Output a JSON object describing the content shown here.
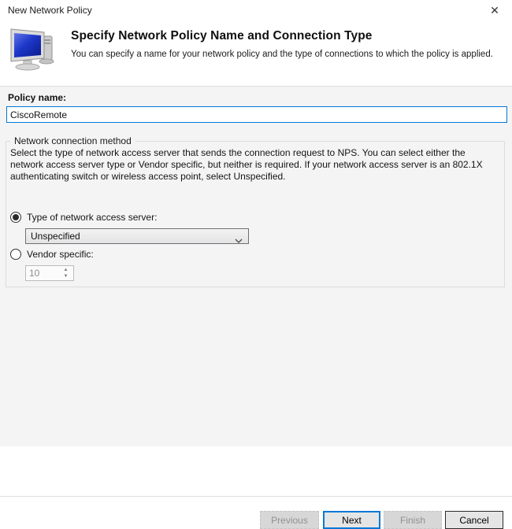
{
  "window": {
    "title": "New Network Policy",
    "close_glyph": "✕"
  },
  "header": {
    "title": "Specify Network Policy Name and Connection Type",
    "subtitle": "You can specify a name for your network policy and the type of connections to which the policy is applied.",
    "icon": "computer-monitor-icon"
  },
  "form": {
    "policy_name_label": "Policy name:",
    "policy_name_value": "CiscoRemote",
    "group": {
      "legend": "Network connection method",
      "description": "Select the type of network access server that sends the connection request to NPS. You can select either the network access server type or Vendor specific, but neither is required.  If your network access server is an 802.1X authenticating switch or wireless access point, select Unspecified.",
      "radio_type": {
        "label": "Type of network access server:",
        "selected": true
      },
      "type_dropdown_value": "Unspecified",
      "radio_vendor": {
        "label": "Vendor specific:",
        "selected": false
      },
      "vendor_value": "10"
    }
  },
  "icons": {
    "spinner_up": "▲",
    "spinner_down": "▼"
  },
  "footer": {
    "buttons": [
      {
        "label": "Previous",
        "state": "disabled"
      },
      {
        "label": "Next",
        "state": "default"
      },
      {
        "label": "Finish",
        "state": "disabled"
      },
      {
        "label": "Cancel",
        "state": "normal"
      }
    ]
  },
  "colors": {
    "accent": "#0078d7",
    "body_bg": "#f5f4f5",
    "header_bg": "#ffffff",
    "screen_blue": "#1d37c8"
  }
}
